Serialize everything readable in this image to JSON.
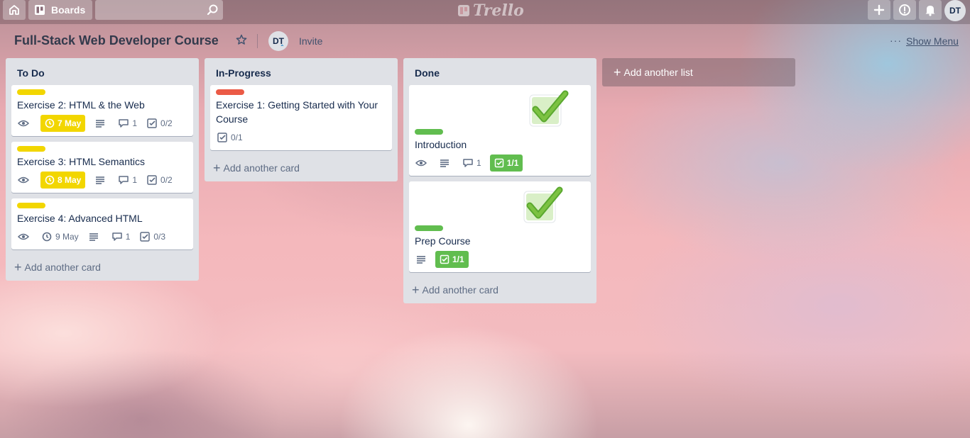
{
  "header": {
    "boards_label": "Boards",
    "logo_text": "Trello",
    "user_initials": "DT",
    "icons": [
      "home-icon",
      "boards-icon",
      "search-icon",
      "plus-icon",
      "info-icon",
      "bell-icon"
    ]
  },
  "board": {
    "title": "Full-Stack Web Developer Course",
    "member_initials": "DT",
    "invite_label": "Invite",
    "more_label": "···",
    "show_menu_label": "Show Menu"
  },
  "lists": [
    {
      "title": "To Do",
      "add_card_label": "Add another card",
      "cards": [
        {
          "label_color": "yellow",
          "title": "Exercise 2: HTML & the Web",
          "watch": true,
          "due": "7 May",
          "due_style": "soon",
          "description": true,
          "comments": "1",
          "checklist": "0/2"
        },
        {
          "label_color": "yellow",
          "title": "Exercise 3: HTML Semantics",
          "watch": true,
          "due": "8 May",
          "due_style": "soon",
          "description": true,
          "comments": "1",
          "checklist": "0/2"
        },
        {
          "label_color": "yellow",
          "title": "Exercise 4: Advanced HTML",
          "watch": true,
          "due": "9 May",
          "due_style": "plain",
          "description": true,
          "comments": "1",
          "checklist": "0/3"
        }
      ]
    },
    {
      "title": "In-Progress",
      "add_card_label": "Add another card",
      "cards": [
        {
          "label_color": "red",
          "title": "Exercise 1: Getting Started with Your Course",
          "checklist": "0/1"
        }
      ]
    },
    {
      "title": "Done",
      "add_card_label": "Add another card",
      "cards": [
        {
          "label_color": "green",
          "title": "Introduction",
          "cover": "checkmark-sticker",
          "watch": true,
          "description": true,
          "comments": "1",
          "checklist": "1/1",
          "checklist_complete": true
        },
        {
          "label_color": "green",
          "title": "Prep Course",
          "cover": "checkmark-sticker",
          "description": true,
          "checklist": "1/1",
          "checklist_complete": true
        }
      ]
    }
  ],
  "add_list_label": "Add another list",
  "colors": {
    "label_yellow": "#f2d600",
    "label_red": "#eb5a46",
    "label_green": "#61bd4f",
    "list_bg": "#dfe1e6"
  }
}
